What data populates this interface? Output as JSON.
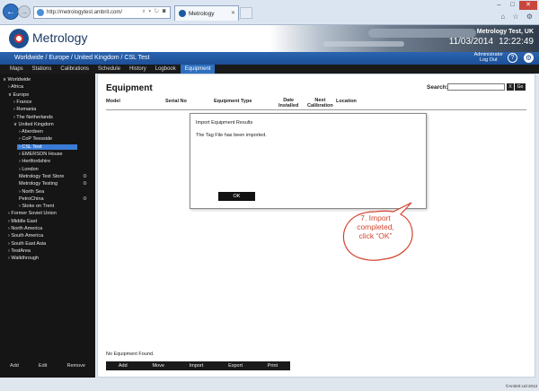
{
  "browser": {
    "url": "http://metrologytest.ambrit.com/",
    "tab_title": "Metrology",
    "address_tools": "⌕ ▾ ↻ ✖",
    "win_minimize": "–",
    "win_maximize": "□",
    "win_close": "✕",
    "tools": "⌂ ☆ ⚙"
  },
  "app": {
    "logo_text": "Metrology",
    "site_name": "Metrology Test, UK",
    "date": "11/03/2014",
    "time": "12:22:49",
    "breadcrumb": "Worldwide / Europe / United Kingdom / CSL Test",
    "user_role": "Administrator",
    "logout": "Log Out",
    "help_glyph": "?",
    "settings_glyph": "⚙"
  },
  "menu": [
    {
      "label": "Maps",
      "active": false
    },
    {
      "label": "Stations",
      "active": false
    },
    {
      "label": "Calibrations",
      "active": false
    },
    {
      "label": "Schedule",
      "active": false
    },
    {
      "label": "History",
      "active": false
    },
    {
      "label": "Logbook",
      "active": false
    },
    {
      "label": "Equipment",
      "active": true
    }
  ],
  "tree": [
    {
      "label": "∨ Worldwide",
      "level": 0
    },
    {
      "label": "› Africa",
      "level": 1
    },
    {
      "label": "∨ Europe",
      "level": 1
    },
    {
      "label": "› France",
      "level": 2
    },
    {
      "label": "› Romania",
      "level": 2
    },
    {
      "label": "› The Netherlands",
      "level": 2
    },
    {
      "label": "∨ United Kingdom",
      "level": 2
    },
    {
      "label": "› Aberdeen",
      "level": 3
    },
    {
      "label": "› CoP Teesside",
      "level": 3
    },
    {
      "label": "› CSL Test",
      "level": 3,
      "selected": true
    },
    {
      "label": "› EMERSON House",
      "level": 3
    },
    {
      "label": "› Hertfordshire",
      "level": 3
    },
    {
      "label": "› London",
      "level": 3
    },
    {
      "label": "Metrology Test Store",
      "level": 3,
      "gear": true
    },
    {
      "label": "Metrology Testing",
      "level": 3,
      "gear": true
    },
    {
      "label": "› North Sea",
      "level": 3
    },
    {
      "label": "PetroChina",
      "level": 3,
      "gear": true
    },
    {
      "label": "› Stoke on Trent",
      "level": 3
    },
    {
      "label": "› Former Soviet Union",
      "level": 1
    },
    {
      "label": "› Middle East",
      "level": 1
    },
    {
      "label": "› North America",
      "level": 1
    },
    {
      "label": "› South America",
      "level": 1
    },
    {
      "label": "› South East Asia",
      "level": 1
    },
    {
      "label": "› TestArea",
      "level": 1
    },
    {
      "label": "› Walkthrough",
      "level": 1
    }
  ],
  "tree_gear_glyph": "⚙",
  "sidebar_actions": {
    "add": "Add",
    "edit": "Edit",
    "remove": "Remove"
  },
  "equipment": {
    "title": "Equipment",
    "search_label": "Search:",
    "search_value": "",
    "search_clear": "X",
    "search_go": "Go",
    "columns": [
      "Model",
      "Serial No",
      "Equipment Type",
      "Date\nInstalled",
      "Next\nCalibration",
      "Location"
    ],
    "empty_message": "No Equipment Found.",
    "actions": [
      "Add",
      "Move",
      "Import",
      "Export",
      "Print"
    ]
  },
  "dialog": {
    "title": "Import Equipment Results",
    "message": "The Tag File has been imported.",
    "ok": "OK"
  },
  "callout": {
    "line1": "7. Import",
    "line2": "completed,",
    "line3": "click “OK”",
    "color": "#d2452f"
  },
  "footer": {
    "copyright": "©Ambrit Ltd 2013"
  },
  "colors": {
    "brand_blue": "#1d4f96",
    "accent": "#2e6fc0",
    "dark": "#151515"
  }
}
